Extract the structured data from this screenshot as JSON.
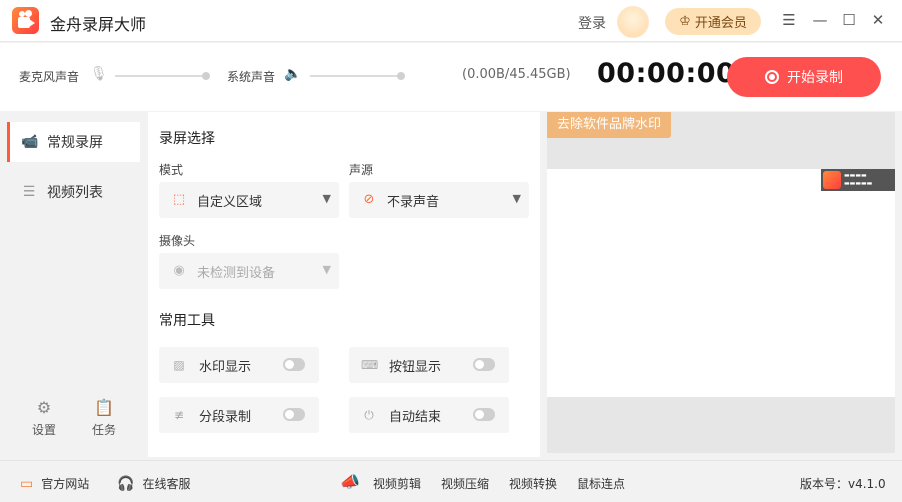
{
  "app": {
    "title": "金舟录屏大师",
    "login": "登录",
    "vip_button": "开通会员"
  },
  "toolbar": {
    "mic_label": "麦克风声音",
    "system_label": "系统声音",
    "storage": "(0.00B/45.45GB)",
    "timer": "00:00:00",
    "record_button": "开始录制"
  },
  "sidebar": {
    "items": [
      {
        "label": "常规录屏",
        "icon": "video-camera-icon",
        "active": true
      },
      {
        "label": "视频列表",
        "icon": "list-icon",
        "active": false
      }
    ],
    "settings_label": "设置",
    "tasks_label": "任务"
  },
  "panel": {
    "screen_section_title": "录屏选择",
    "mode_label": "模式",
    "mode_value": "自定义区域",
    "audio_label": "声源",
    "audio_value": "不录声音",
    "camera_label": "摄像头",
    "camera_value": "未检测到设备",
    "tools_section_title": "常用工具",
    "tools": [
      {
        "label": "水印显示",
        "enabled": false
      },
      {
        "label": "按钮显示",
        "enabled": false
      },
      {
        "label": "分段录制",
        "enabled": false
      },
      {
        "label": "自动结束",
        "enabled": false
      }
    ]
  },
  "preview": {
    "remove_watermark_button": "去除软件品牌水印"
  },
  "statusbar": {
    "website": "官方网站",
    "support": "在线客服",
    "links": [
      "视频剪辑",
      "视频压缩",
      "视频转换",
      "鼠标连点"
    ],
    "version": "版本号：v4.1.0"
  }
}
